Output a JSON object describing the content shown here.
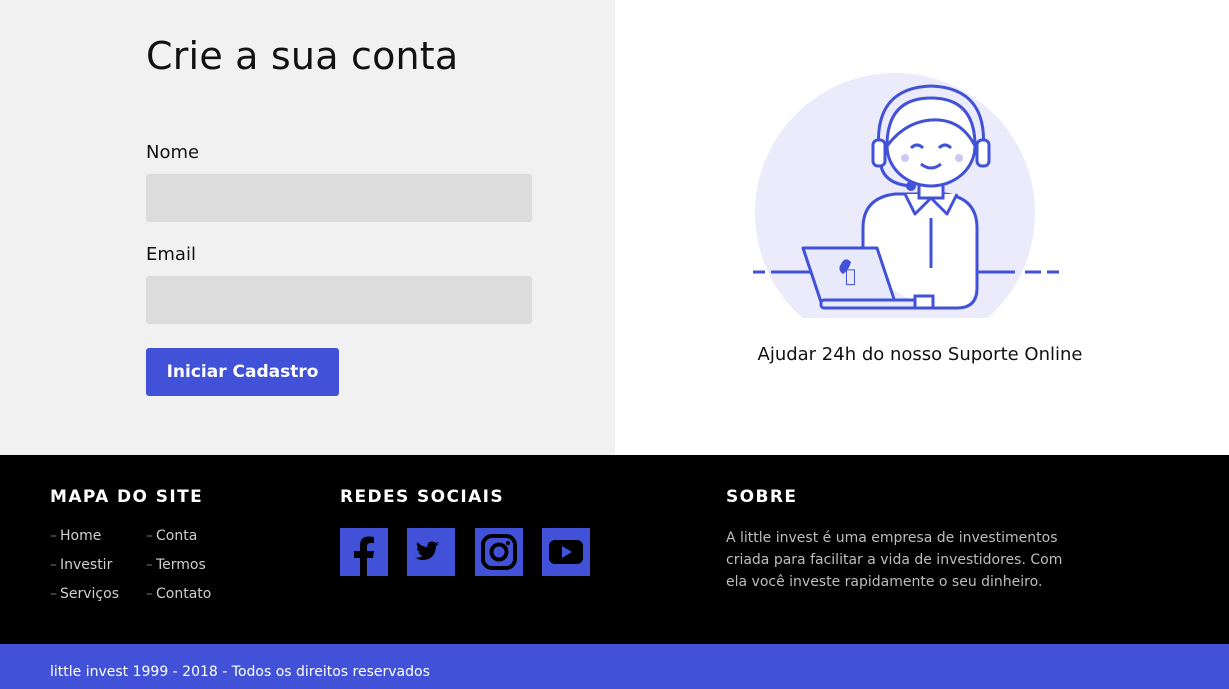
{
  "form": {
    "title": "Crie a sua conta",
    "name_label": "Nome",
    "name_value": "",
    "email_label": "Email",
    "email_value": "",
    "submit_label": "Iniciar Cadastro"
  },
  "support": {
    "illustration_icon": "support-agent-illustration",
    "caption": "Ajudar 24h do nosso Suporte Online"
  },
  "footer": {
    "sitemap": {
      "heading": "MAPA DO SITE",
      "links": [
        "Home",
        "Conta",
        "Investir",
        "Termos",
        "Serviços",
        "Contato"
      ]
    },
    "social": {
      "heading": "REDES SOCIAIS",
      "icons": [
        "facebook-icon",
        "twitter-icon",
        "instagram-icon",
        "youtube-icon"
      ]
    },
    "about": {
      "heading": "SOBRE",
      "text": "A little invest é uma empresa de investimentos criada para facilitar a vida de investidores. Com ela você investe rapidamente o seu dinheiro."
    },
    "copyright": "little invest 1999 - 2018 - Todos os direitos reservados"
  },
  "colors": {
    "accent": "#4152d9",
    "form_bg": "#f1f1f1",
    "input_bg": "#dcdcdc",
    "footer_bg": "#000000",
    "illustration_circle": "#ebebfb"
  }
}
